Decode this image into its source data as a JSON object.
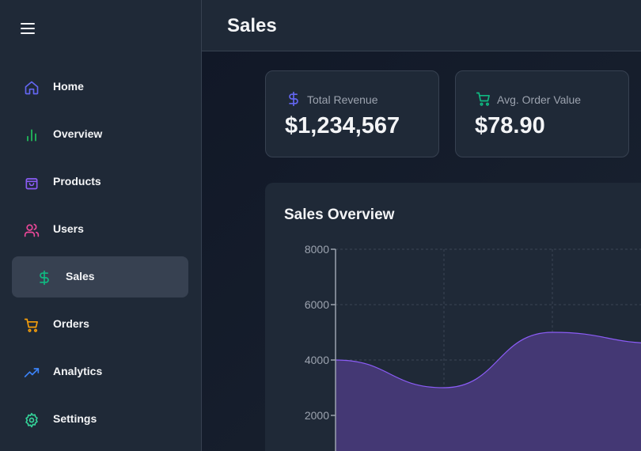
{
  "page": {
    "title": "Sales"
  },
  "sidebar": {
    "items": [
      {
        "label": "Home",
        "icon": "home-icon",
        "color": "#6366f1"
      },
      {
        "label": "Overview",
        "icon": "bar-chart-icon",
        "color": "#22c55e"
      },
      {
        "label": "Products",
        "icon": "shopping-bag-icon",
        "color": "#8b5cf6"
      },
      {
        "label": "Users",
        "icon": "users-icon",
        "color": "#ec4899"
      },
      {
        "label": "Sales",
        "icon": "dollar-icon",
        "color": "#10b981",
        "active": true
      },
      {
        "label": "Orders",
        "icon": "cart-icon",
        "color": "#f59e0b"
      },
      {
        "label": "Analytics",
        "icon": "trending-up-icon",
        "color": "#3b82f6"
      },
      {
        "label": "Settings",
        "icon": "gear-icon",
        "color": "#34d399"
      }
    ]
  },
  "stats": [
    {
      "label": "Total Revenue",
      "value": "$1,234,567",
      "icon": "dollar-icon",
      "color": "#6366f1"
    },
    {
      "label": "Avg. Order Value",
      "value": "$78.90",
      "icon": "cart-icon",
      "color": "#10b981"
    }
  ],
  "chart": {
    "title": "Sales Overview"
  },
  "chart_data": {
    "type": "area",
    "title": "Sales Overview",
    "x": [
      0,
      1,
      2,
      3
    ],
    "values": [
      4000,
      3000,
      5000,
      4600
    ],
    "yticks": [
      "8000",
      "6000",
      "4000",
      "2000"
    ],
    "ylim": [
      0,
      8000
    ],
    "grid": true,
    "series_color": "#8b5cf6",
    "fill_color": "#443874"
  }
}
